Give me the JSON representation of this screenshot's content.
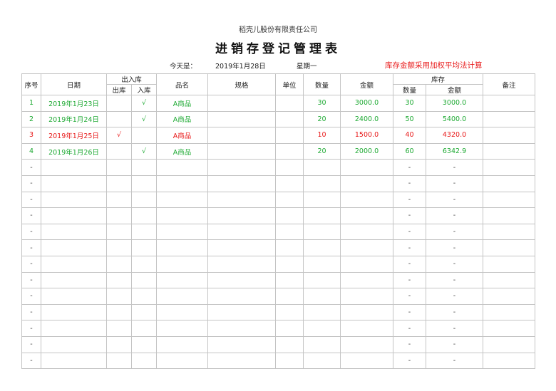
{
  "company": "稻壳儿股份有限责任公司",
  "title": "进销存登记管理表",
  "info": {
    "today_label": "今天是：",
    "date": "2019年1月28日",
    "weekday": "星期一",
    "note": "库存金额采用加权平均法计算"
  },
  "colors": {
    "in_row": "#1faa34",
    "out_row": "#e81919",
    "note": "#e81919"
  },
  "headers": {
    "seq": "序号",
    "date": "日期",
    "inout": "出入库",
    "out": "出库",
    "in": "入库",
    "name": "品名",
    "spec": "规格",
    "unit": "单位",
    "qty": "数量",
    "amount": "金额",
    "stock": "库存",
    "stock_qty": "数量",
    "stock_amount": "金额",
    "remark": "备注"
  },
  "rows": [
    {
      "seq": "1",
      "date": "2019年1月23日",
      "out": "",
      "in": "√",
      "name": "A商品",
      "spec": "",
      "unit": "",
      "qty": "30",
      "amount": "3000.0",
      "stock_qty": "30",
      "stock_amount": "3000.0",
      "remark": "",
      "type": "in"
    },
    {
      "seq": "2",
      "date": "2019年1月24日",
      "out": "",
      "in": "√",
      "name": "A商品",
      "spec": "",
      "unit": "",
      "qty": "20",
      "amount": "2400.0",
      "stock_qty": "50",
      "stock_amount": "5400.0",
      "remark": "",
      "type": "in"
    },
    {
      "seq": "3",
      "date": "2019年1月25日",
      "out": "√",
      "in": "",
      "name": "A商品",
      "spec": "",
      "unit": "",
      "qty": "10",
      "amount": "1500.0",
      "stock_qty": "40",
      "stock_amount": "4320.0",
      "remark": "",
      "type": "out"
    },
    {
      "seq": "4",
      "date": "2019年1月26日",
      "out": "",
      "in": "√",
      "name": "A商品",
      "spec": "",
      "unit": "",
      "qty": "20",
      "amount": "2000.0",
      "stock_qty": "60",
      "stock_amount": "6342.9",
      "remark": "",
      "type": "in"
    },
    {
      "seq": "-",
      "date": "",
      "out": "",
      "in": "",
      "name": "",
      "spec": "",
      "unit": "",
      "qty": "",
      "amount": "",
      "stock_qty": "-",
      "stock_amount": "-",
      "remark": "",
      "type": "blank"
    },
    {
      "seq": "-",
      "date": "",
      "out": "",
      "in": "",
      "name": "",
      "spec": "",
      "unit": "",
      "qty": "",
      "amount": "",
      "stock_qty": "-",
      "stock_amount": "-",
      "remark": "",
      "type": "blank"
    },
    {
      "seq": "-",
      "date": "",
      "out": "",
      "in": "",
      "name": "",
      "spec": "",
      "unit": "",
      "qty": "",
      "amount": "",
      "stock_qty": "-",
      "stock_amount": "-",
      "remark": "",
      "type": "blank"
    },
    {
      "seq": "-",
      "date": "",
      "out": "",
      "in": "",
      "name": "",
      "spec": "",
      "unit": "",
      "qty": "",
      "amount": "",
      "stock_qty": "-",
      "stock_amount": "-",
      "remark": "",
      "type": "blank"
    },
    {
      "seq": "-",
      "date": "",
      "out": "",
      "in": "",
      "name": "",
      "spec": "",
      "unit": "",
      "qty": "",
      "amount": "",
      "stock_qty": "-",
      "stock_amount": "-",
      "remark": "",
      "type": "blank"
    },
    {
      "seq": "-",
      "date": "",
      "out": "",
      "in": "",
      "name": "",
      "spec": "",
      "unit": "",
      "qty": "",
      "amount": "",
      "stock_qty": "-",
      "stock_amount": "-",
      "remark": "",
      "type": "blank"
    },
    {
      "seq": "-",
      "date": "",
      "out": "",
      "in": "",
      "name": "",
      "spec": "",
      "unit": "",
      "qty": "",
      "amount": "",
      "stock_qty": "-",
      "stock_amount": "-",
      "remark": "",
      "type": "blank"
    },
    {
      "seq": "-",
      "date": "",
      "out": "",
      "in": "",
      "name": "",
      "spec": "",
      "unit": "",
      "qty": "",
      "amount": "",
      "stock_qty": "-",
      "stock_amount": "-",
      "remark": "",
      "type": "blank"
    },
    {
      "seq": "-",
      "date": "",
      "out": "",
      "in": "",
      "name": "",
      "spec": "",
      "unit": "",
      "qty": "",
      "amount": "",
      "stock_qty": "-",
      "stock_amount": "-",
      "remark": "",
      "type": "blank"
    },
    {
      "seq": "-",
      "date": "",
      "out": "",
      "in": "",
      "name": "",
      "spec": "",
      "unit": "",
      "qty": "",
      "amount": "",
      "stock_qty": "-",
      "stock_amount": "-",
      "remark": "",
      "type": "blank"
    },
    {
      "seq": "-",
      "date": "",
      "out": "",
      "in": "",
      "name": "",
      "spec": "",
      "unit": "",
      "qty": "",
      "amount": "",
      "stock_qty": "-",
      "stock_amount": "-",
      "remark": "",
      "type": "blank"
    },
    {
      "seq": "-",
      "date": "",
      "out": "",
      "in": "",
      "name": "",
      "spec": "",
      "unit": "",
      "qty": "",
      "amount": "",
      "stock_qty": "-",
      "stock_amount": "-",
      "remark": "",
      "type": "blank"
    },
    {
      "seq": "-",
      "date": "",
      "out": "",
      "in": "",
      "name": "",
      "spec": "",
      "unit": "",
      "qty": "",
      "amount": "",
      "stock_qty": "-",
      "stock_amount": "-",
      "remark": "",
      "type": "blank"
    }
  ]
}
